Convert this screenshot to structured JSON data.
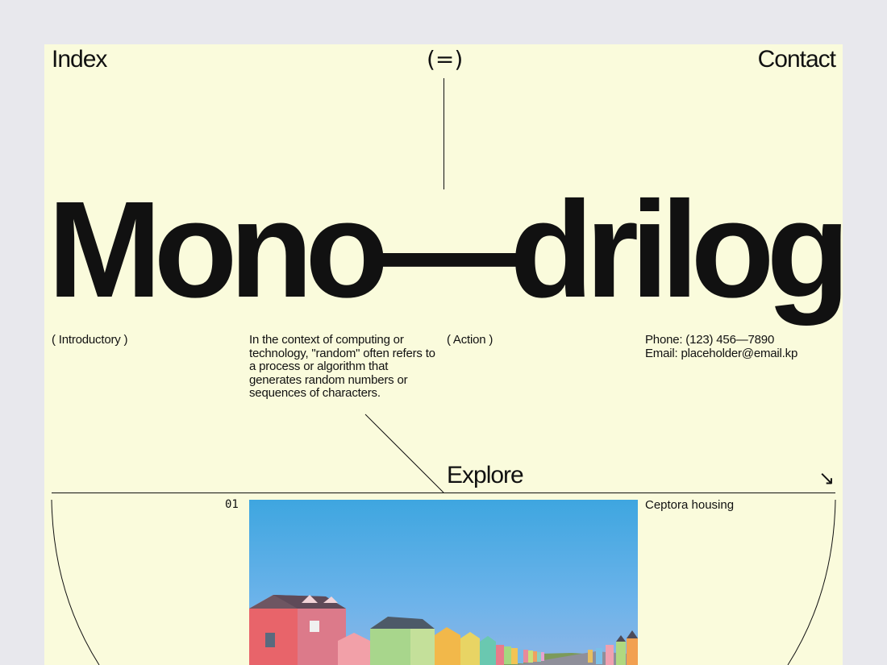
{
  "nav": {
    "index_label": "Index",
    "menu_label": "(=)",
    "contact_label": "Contact"
  },
  "hero": {
    "title": "Mono—drilogy"
  },
  "intro": {
    "label": "( Introductory )",
    "text": "In the context of computing or technology, \"random\" often refers to a process or algorithm that generates random numbers or sequences of characters."
  },
  "action": {
    "label": "( Action )"
  },
  "contact": {
    "phone": "Phone: (123) 456—7890",
    "email": "Email: placeholder@email.kp"
  },
  "explore": {
    "label": "Explore",
    "arrow": "↘"
  },
  "items": [
    {
      "number": "01",
      "title": "Ceptora housing",
      "image_icon": "colorful-houses-photo"
    }
  ],
  "colors": {
    "background": "#fafbdc",
    "outer": "#e8e8ed",
    "text": "#111111",
    "sky": "#3ea6e0"
  }
}
